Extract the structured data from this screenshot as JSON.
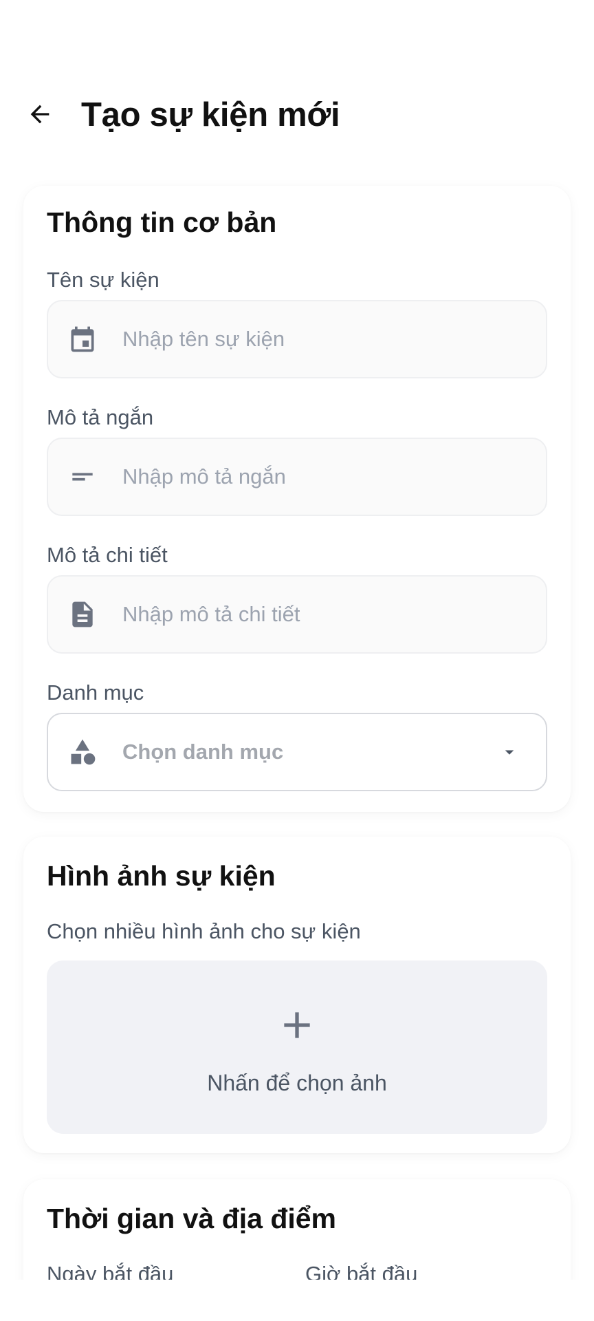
{
  "header": {
    "title": "Tạo sự kiện mới",
    "back_icon": "arrow-left-icon"
  },
  "basic_info": {
    "section_title": "Thông tin cơ bản",
    "event_name": {
      "label": "Tên sự kiện",
      "placeholder": "Nhập tên sự kiện",
      "icon": "calendar-icon"
    },
    "short_description": {
      "label": "Mô tả ngắn",
      "placeholder": "Nhập mô tả ngắn",
      "icon": "short-text-icon"
    },
    "detailed_description": {
      "label": "Mô tả chi tiết",
      "placeholder": "Nhập mô tả chi tiết",
      "icon": "document-icon"
    },
    "category": {
      "label": "Danh mục",
      "placeholder": "Chọn danh mục",
      "icon": "category-shapes-icon",
      "arrow_icon": "dropdown-arrow-icon"
    }
  },
  "images": {
    "section_title": "Hình ảnh sự kiện",
    "subtitle": "Chọn nhiều hình ảnh cho sự kiện",
    "upload_label": "Nhấn để chọn ảnh",
    "upload_icon": "plus-icon"
  },
  "time_location": {
    "section_title": "Thời gian và địa điểm",
    "start_date_label": "Ngày bắt đầu",
    "start_time_label": "Giờ bắt đầu"
  },
  "colors": {
    "title_text": "#111111",
    "label_text": "#4b5563",
    "placeholder_text": "#9ca3af",
    "icon": "#6b7280",
    "upload_bg": "#f1f2f6"
  }
}
